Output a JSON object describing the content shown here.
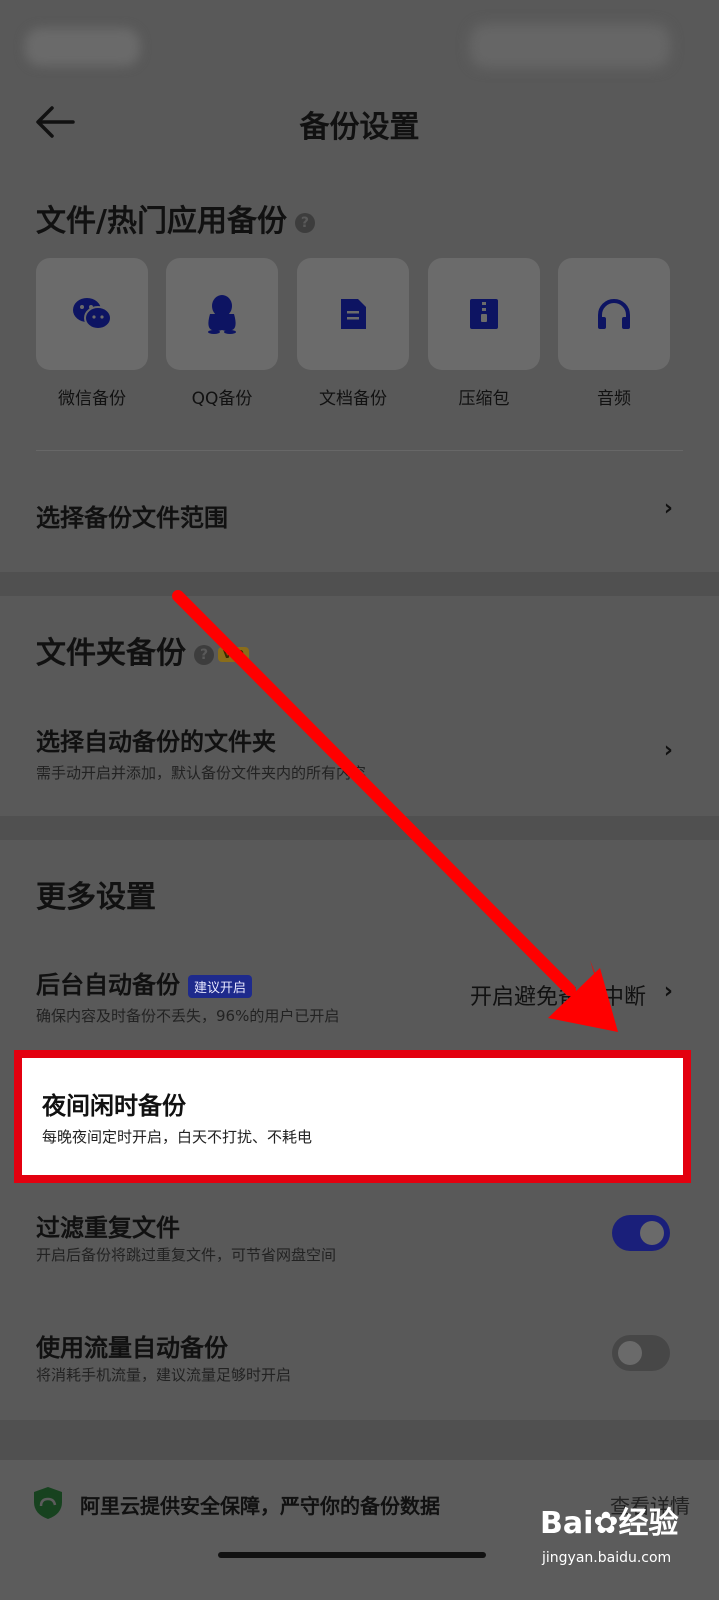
{
  "header": {
    "title": "备份设置"
  },
  "file_backup": {
    "title": "文件/热门应用备份",
    "help": "?",
    "apps": [
      {
        "label": "微信备份",
        "icon": "wechat-icon"
      },
      {
        "label": "QQ备份",
        "icon": "qq-penguin-icon"
      },
      {
        "label": "文档备份",
        "icon": "document-icon"
      },
      {
        "label": "压缩包",
        "icon": "zip-icon"
      },
      {
        "label": "音频",
        "icon": "headphones-icon"
      }
    ],
    "range_row": {
      "title": "选择备份文件范围",
      "chevron": "›"
    }
  },
  "folder_backup": {
    "title": "文件夹备份",
    "help": "?",
    "vip": "VIP",
    "row": {
      "title": "选择自动备份的文件夹",
      "subtitle": "需手动开启并添加，默认备份文件夹内的所有内容",
      "chevron": "›"
    }
  },
  "more_settings": {
    "title": "更多设置",
    "background": {
      "title": "后台自动备份",
      "badge": "建议开启",
      "subtitle": "确保内容及时备份不丢失，96%的用户已开启",
      "value": "开启避免备份中断",
      "chevron": "›"
    },
    "night": {
      "title": "夜间闲时备份",
      "subtitle": "每晚夜间定时开启，白天不打扰、不耗电"
    },
    "dedupe": {
      "title": "过滤重复文件",
      "subtitle": "开启后备份将跳过重复文件，可节省网盘空间",
      "enabled": true
    },
    "cellular": {
      "title": "使用流量自动备份",
      "subtitle": "将消耗手机流量，建议流量足够时开启",
      "enabled": false
    }
  },
  "footer": {
    "text": "阿里云提供安全保障，严守你的备份数据",
    "link": "查看详情",
    "icon": "aliyun-shield-icon"
  },
  "watermark": {
    "brand": "Bai",
    "brand2": "经验",
    "url": "jingyan.baidu.com"
  },
  "colors": {
    "accent": "#1a1f7a",
    "highlight": "#e3000f",
    "arrow": "#ff0000"
  }
}
